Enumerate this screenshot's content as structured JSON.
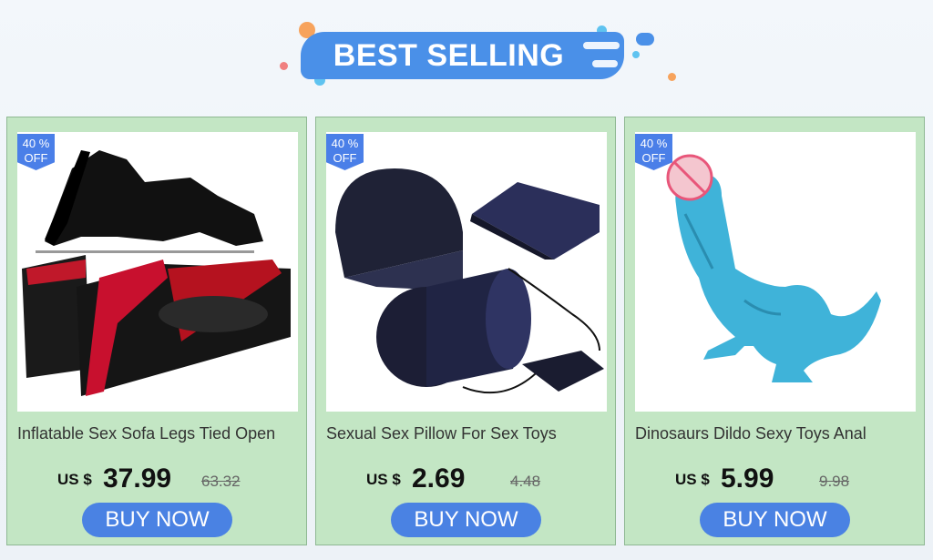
{
  "header": {
    "title": "BEST SELLING"
  },
  "colors": {
    "card_bg": "#c3e6c4",
    "accent": "#4a82e3",
    "badge": "#4a7fe8"
  },
  "products": [
    {
      "badge_line1": "40 %",
      "badge_line2": "OFF",
      "title": "Inflatable Sex Sofa Legs Tied Open",
      "currency": "US $",
      "price": "37.99",
      "old_price": "63.32",
      "button": "BUY NOW"
    },
    {
      "badge_line1": "40 %",
      "badge_line2": "OFF",
      "title": "Sexual Sex Pillow For Sex Toys",
      "currency": "US $",
      "price": "2.69",
      "old_price": "4.48",
      "button": "BUY NOW"
    },
    {
      "badge_line1": "40 %",
      "badge_line2": "OFF",
      "title": "Dinosaurs Dildo Sexy Toys Anal",
      "currency": "US $",
      "price": "5.99",
      "old_price": "9.98",
      "button": "BUY NOW"
    }
  ]
}
